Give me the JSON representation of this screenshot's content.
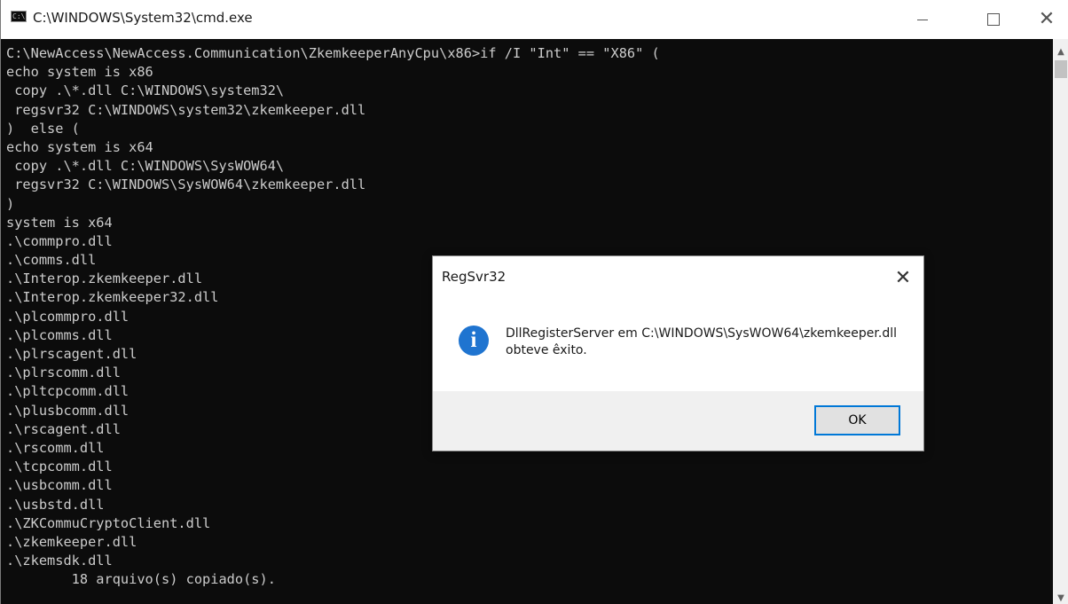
{
  "window": {
    "title": "C:\\WINDOWS\\System32\\cmd.exe",
    "icon_label": "C:\\",
    "controls": {
      "minimize": "—",
      "maximize": "□",
      "close": "✕"
    }
  },
  "console": {
    "lines": [
      "C:\\NewAccess\\NewAccess.Communication\\ZkemkeeperAnyCpu\\x86>if /I \"Int\" == \"X86\" (",
      "echo system is x86",
      " copy .\\*.dll C:\\WINDOWS\\system32\\",
      " regsvr32 C:\\WINDOWS\\system32\\zkemkeeper.dll",
      ")  else (",
      "echo system is x64",
      " copy .\\*.dll C:\\WINDOWS\\SysWOW64\\",
      " regsvr32 C:\\WINDOWS\\SysWOW64\\zkemkeeper.dll",
      ")",
      "system is x64",
      ".\\commpro.dll",
      ".\\comms.dll",
      ".\\Interop.zkemkeeper.dll",
      ".\\Interop.zkemkeeper32.dll",
      ".\\plcommpro.dll",
      ".\\plcomms.dll",
      ".\\plrscagent.dll",
      ".\\plrscomm.dll",
      ".\\pltcpcomm.dll",
      ".\\plusbcomm.dll",
      ".\\rscagent.dll",
      ".\\rscomm.dll",
      ".\\tcpcomm.dll",
      ".\\usbcomm.dll",
      ".\\usbstd.dll",
      ".\\ZKCommuCryptoClient.dll",
      ".\\zkemkeeper.dll",
      ".\\zkemsdk.dll",
      "        18 arquivo(s) copiado(s)."
    ]
  },
  "scrollbar": {
    "up_arrow": "▲",
    "down_arrow": "▼"
  },
  "dialog": {
    "title": "RegSvr32",
    "close_glyph": "✕",
    "icon_name": "info-icon",
    "icon_glyph": "i",
    "icon_color": "#1f74d0",
    "message_line1": "DllRegisterServer em C:\\WINDOWS\\SysWOW64\\zkemkeeper.dll",
    "message_line2": " obteve êxito.",
    "ok_label": "OK",
    "ok_border_color": "#0078d7"
  }
}
